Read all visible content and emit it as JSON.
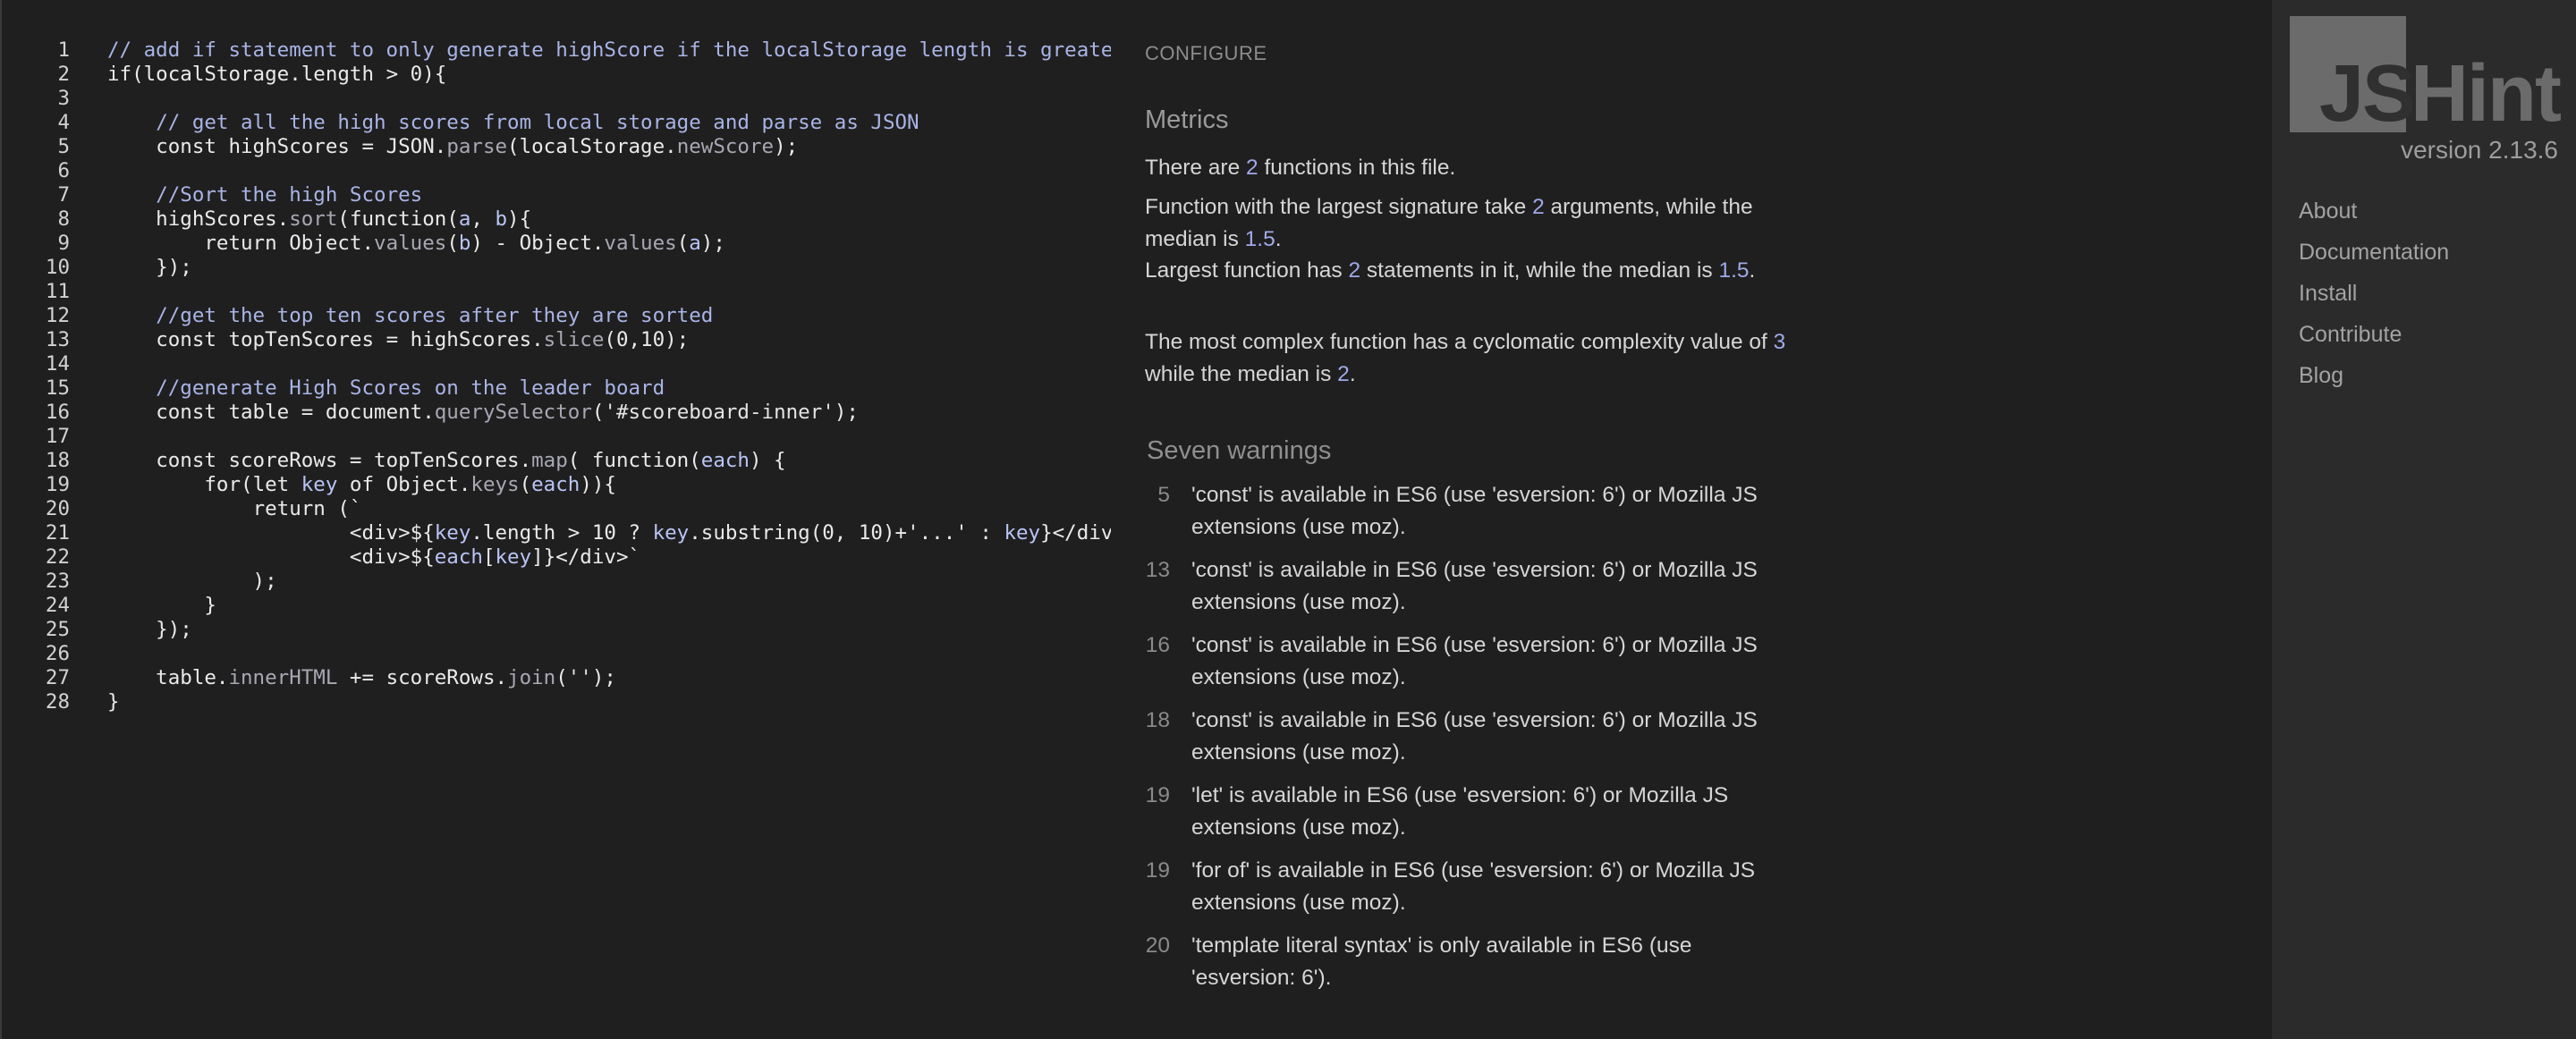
{
  "editor": {
    "lines": [
      {
        "n": "1",
        "tokens": [
          [
            "c",
            "// add if statement to only generate highScore if the localStorage length is greater"
          ]
        ]
      },
      {
        "n": "2",
        "tokens": [
          [
            "k",
            "if"
          ],
          [
            "i",
            "("
          ],
          [
            "i",
            "localStorage"
          ],
          [
            "i",
            "."
          ],
          [
            "i",
            "length"
          ],
          [
            "i",
            " > 0){"
          ]
        ]
      },
      {
        "n": "3",
        "tokens": []
      },
      {
        "n": "4",
        "tokens": [
          [
            "i",
            "    "
          ],
          [
            "c",
            "// get all the high scores from local storage and parse as JSON"
          ]
        ]
      },
      {
        "n": "5",
        "tokens": [
          [
            "i",
            "    "
          ],
          [
            "k",
            "const"
          ],
          [
            "i",
            " highScores = JSON."
          ],
          [
            "p",
            "parse"
          ],
          [
            "i",
            "(localStorage."
          ],
          [
            "p",
            "newScore"
          ],
          [
            "i",
            ");"
          ]
        ]
      },
      {
        "n": "6",
        "tokens": []
      },
      {
        "n": "7",
        "tokens": [
          [
            "i",
            "    "
          ],
          [
            "c",
            "//Sort the high Scores"
          ]
        ]
      },
      {
        "n": "8",
        "tokens": [
          [
            "i",
            "    highScores."
          ],
          [
            "p",
            "sort"
          ],
          [
            "i",
            "("
          ],
          [
            "k",
            "function"
          ],
          [
            "i",
            "("
          ],
          [
            "v",
            "a"
          ],
          [
            "i",
            ", "
          ],
          [
            "v",
            "b"
          ],
          [
            "i",
            "){"
          ]
        ]
      },
      {
        "n": "9",
        "tokens": [
          [
            "i",
            "        "
          ],
          [
            "k",
            "return"
          ],
          [
            "i",
            " Object."
          ],
          [
            "p",
            "values"
          ],
          [
            "i",
            "("
          ],
          [
            "v",
            "b"
          ],
          [
            "i",
            ") - Object."
          ],
          [
            "p",
            "values"
          ],
          [
            "i",
            "("
          ],
          [
            "v",
            "a"
          ],
          [
            "i",
            ");"
          ]
        ]
      },
      {
        "n": "10",
        "tokens": [
          [
            "i",
            "    });"
          ]
        ]
      },
      {
        "n": "11",
        "tokens": []
      },
      {
        "n": "12",
        "tokens": [
          [
            "i",
            "    "
          ],
          [
            "c",
            "//get the top ten scores after they are sorted"
          ]
        ]
      },
      {
        "n": "13",
        "tokens": [
          [
            "i",
            "    "
          ],
          [
            "k",
            "const"
          ],
          [
            "i",
            " topTenScores = highScores."
          ],
          [
            "p",
            "slice"
          ],
          [
            "i",
            "(0,10);"
          ]
        ]
      },
      {
        "n": "14",
        "tokens": []
      },
      {
        "n": "15",
        "tokens": [
          [
            "i",
            "    "
          ],
          [
            "c",
            "//generate High Scores on the leader board"
          ]
        ]
      },
      {
        "n": "16",
        "tokens": [
          [
            "i",
            "    "
          ],
          [
            "k",
            "const"
          ],
          [
            "i",
            " table = document."
          ],
          [
            "p",
            "querySelector"
          ],
          [
            "i",
            "("
          ],
          [
            "s",
            "'#scoreboard-inner'"
          ],
          [
            "i",
            ");"
          ]
        ]
      },
      {
        "n": "17",
        "tokens": []
      },
      {
        "n": "18",
        "tokens": [
          [
            "i",
            "    "
          ],
          [
            "k",
            "const"
          ],
          [
            "i",
            " scoreRows = topTenScores."
          ],
          [
            "p",
            "map"
          ],
          [
            "i",
            "( "
          ],
          [
            "k",
            "function"
          ],
          [
            "i",
            "("
          ],
          [
            "v",
            "each"
          ],
          [
            "i",
            ") {"
          ]
        ]
      },
      {
        "n": "19",
        "tokens": [
          [
            "i",
            "        "
          ],
          [
            "k",
            "for"
          ],
          [
            "i",
            "("
          ],
          [
            "k",
            "let"
          ],
          [
            "i",
            " "
          ],
          [
            "v",
            "key"
          ],
          [
            "i",
            " of Object."
          ],
          [
            "p",
            "keys"
          ],
          [
            "i",
            "("
          ],
          [
            "v",
            "each"
          ],
          [
            "i",
            ")){"
          ]
        ]
      },
      {
        "n": "20",
        "tokens": [
          [
            "i",
            "            "
          ],
          [
            "k",
            "return"
          ],
          [
            "i",
            " (`"
          ]
        ]
      },
      {
        "n": "21",
        "tokens": [
          [
            "i",
            "                    <div>${"
          ],
          [
            "v",
            "key"
          ],
          [
            "i",
            ".length > 10 ? "
          ],
          [
            "v",
            "key"
          ],
          [
            "i",
            ".substring(0, 10)+'...' : "
          ],
          [
            "v",
            "key"
          ],
          [
            "i",
            "}</div>"
          ]
        ]
      },
      {
        "n": "22",
        "tokens": [
          [
            "i",
            "                    <div>${"
          ],
          [
            "v",
            "each"
          ],
          [
            "i",
            "["
          ],
          [
            "v",
            "key"
          ],
          [
            "i",
            "]}</div>`"
          ]
        ]
      },
      {
        "n": "23",
        "tokens": [
          [
            "i",
            "            );"
          ]
        ]
      },
      {
        "n": "24",
        "tokens": [
          [
            "i",
            "        }"
          ]
        ]
      },
      {
        "n": "25",
        "tokens": [
          [
            "i",
            "    });"
          ]
        ]
      },
      {
        "n": "26",
        "tokens": []
      },
      {
        "n": "27",
        "tokens": [
          [
            "i",
            "    table."
          ],
          [
            "p",
            "innerHTML"
          ],
          [
            "i",
            " += scoreRows."
          ],
          [
            "p",
            "join"
          ],
          [
            "i",
            "("
          ],
          [
            "s",
            "''"
          ],
          [
            "i",
            ");"
          ]
        ]
      },
      {
        "n": "28",
        "tokens": [
          [
            "i",
            "}"
          ]
        ]
      }
    ]
  },
  "report": {
    "configure_label": "CONFIGURE",
    "metrics_title": "Metrics",
    "metrics": [
      [
        [
          "t",
          "There are "
        ],
        [
          "n",
          "2"
        ],
        [
          "t",
          " functions in this file."
        ]
      ],
      [
        [
          "t",
          "Function with the largest signature take "
        ],
        [
          "n",
          "2"
        ],
        [
          "t",
          " arguments, while the median is "
        ],
        [
          "n",
          "1.5"
        ],
        [
          "t",
          "."
        ]
      ],
      [
        [
          "t",
          "Largest function has "
        ],
        [
          "n",
          "2"
        ],
        [
          "t",
          " statements in it, while the median is "
        ],
        [
          "n",
          "1.5"
        ],
        [
          "t",
          "."
        ]
      ],
      [
        [
          "t",
          "The most complex function has a cyclomatic complexity value of "
        ],
        [
          "n",
          "3"
        ],
        [
          "t",
          " while the median is "
        ],
        [
          "n",
          "2"
        ],
        [
          "t",
          "."
        ]
      ]
    ],
    "warnings_title": "Seven warnings",
    "warnings": [
      {
        "line": "5",
        "text": "'const' is available in ES6 (use 'esversion: 6') or Mozilla JS extensions (use moz)."
      },
      {
        "line": "13",
        "text": "'const' is available in ES6 (use 'esversion: 6') or Mozilla JS extensions (use moz)."
      },
      {
        "line": "16",
        "text": "'const' is available in ES6 (use 'esversion: 6') or Mozilla JS extensions (use moz)."
      },
      {
        "line": "18",
        "text": "'const' is available in ES6 (use 'esversion: 6') or Mozilla JS extensions (use moz)."
      },
      {
        "line": "19",
        "text": "'let' is available in ES6 (use 'esversion: 6') or Mozilla JS extensions (use moz)."
      },
      {
        "line": "19",
        "text": "'for of' is available in ES6 (use 'esversion: 6') or Mozilla JS extensions (use moz)."
      },
      {
        "line": "20",
        "text": "'template literal syntax' is only available in ES6 (use 'esversion: 6')."
      }
    ]
  },
  "sidebar": {
    "logo": {
      "js": "JS",
      "hint": "Hint"
    },
    "version": "version 2.13.6",
    "nav": [
      "About",
      "Documentation",
      "Install",
      "Contribute",
      "Blog"
    ]
  },
  "colors": {
    "background": "#1f1f1f",
    "sidebar": "#2b2b2b",
    "number_accent": "#9fa9e9",
    "comment": "#a9b4e6"
  }
}
